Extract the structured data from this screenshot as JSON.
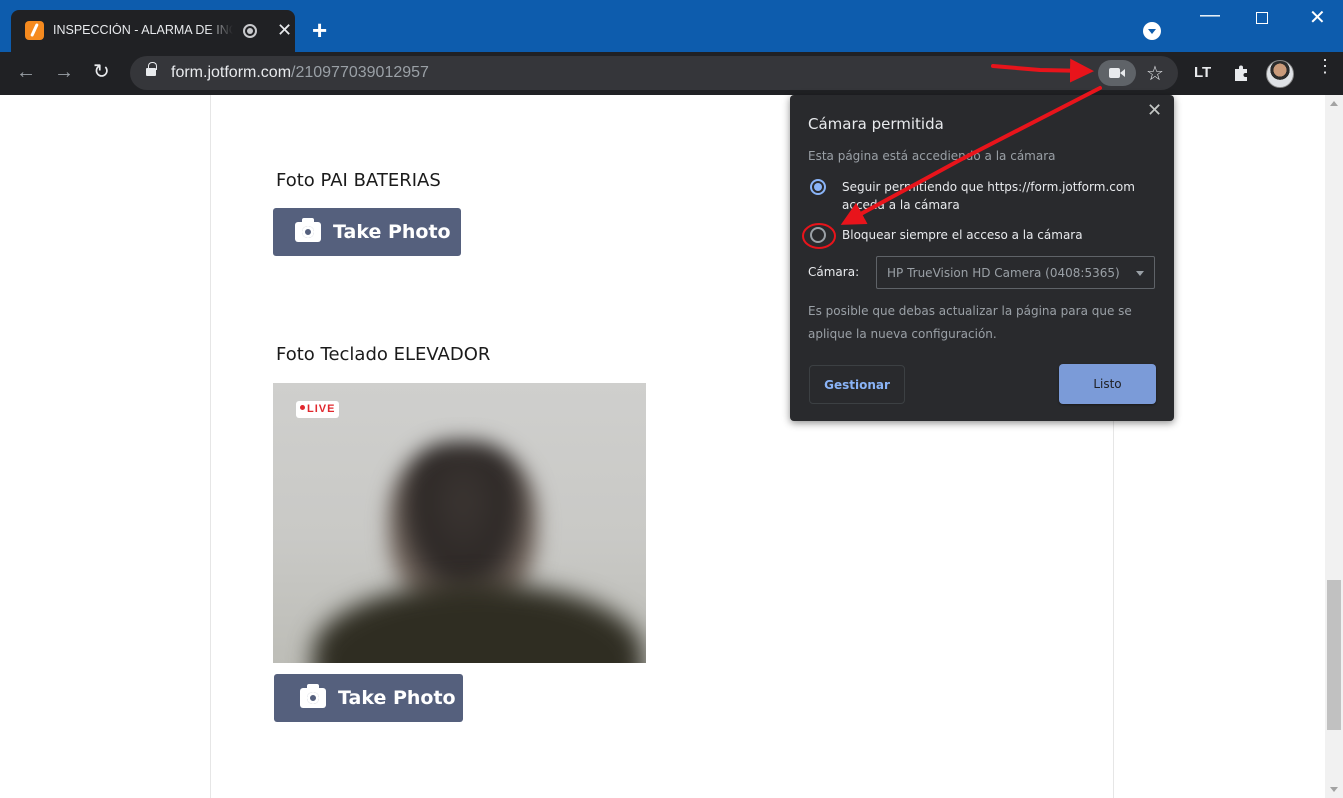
{
  "browser": {
    "tab": {
      "title": "INSPECCIÓN - ALARMA DE INCENDIO",
      "favicon": "jotform-icon",
      "close": "✕"
    },
    "new_tab": "+",
    "window_controls": {
      "minimize": "—",
      "close": "✕"
    },
    "nav": {
      "back": "←",
      "forward": "→",
      "reload": "↻"
    },
    "url": {
      "host": "form.jotform.com",
      "path": "/210977039012957"
    },
    "star": "☆",
    "ext_label": "LT",
    "menu": "⋮"
  },
  "form": {
    "questions": [
      {
        "label": "Foto PAI BATERIAS",
        "button": "Take Photo"
      },
      {
        "label": "Foto Teclado ELEVADOR",
        "button": "Take Photo",
        "live_badge": "LIVE"
      }
    ]
  },
  "camera_bubble": {
    "title": "Cámara permitida",
    "subtitle": "Esta página está accediendo a la cámara",
    "option_allow": "Seguir permitiendo que https://form.jotform.com acceda a la cámara",
    "option_block": "Bloquear siempre el acceso a la cámara",
    "selected_option": "allow",
    "camera_label": "Cámara:",
    "camera_value": "HP TrueVision HD Camera (0408:5365)",
    "note": "Es posible que debas actualizar la página para que se aplique la nueva configuración.",
    "manage_button": "Gestionar",
    "done_button": "Listo",
    "close": "✕"
  },
  "colors": {
    "titlebar": "#0d5cad",
    "toolbar": "#202124",
    "take_photo_button": "#55607d",
    "annotation_arrow": "#e8141b",
    "bubble_bg": "#292a2d",
    "accent": "#8ab4f8"
  }
}
